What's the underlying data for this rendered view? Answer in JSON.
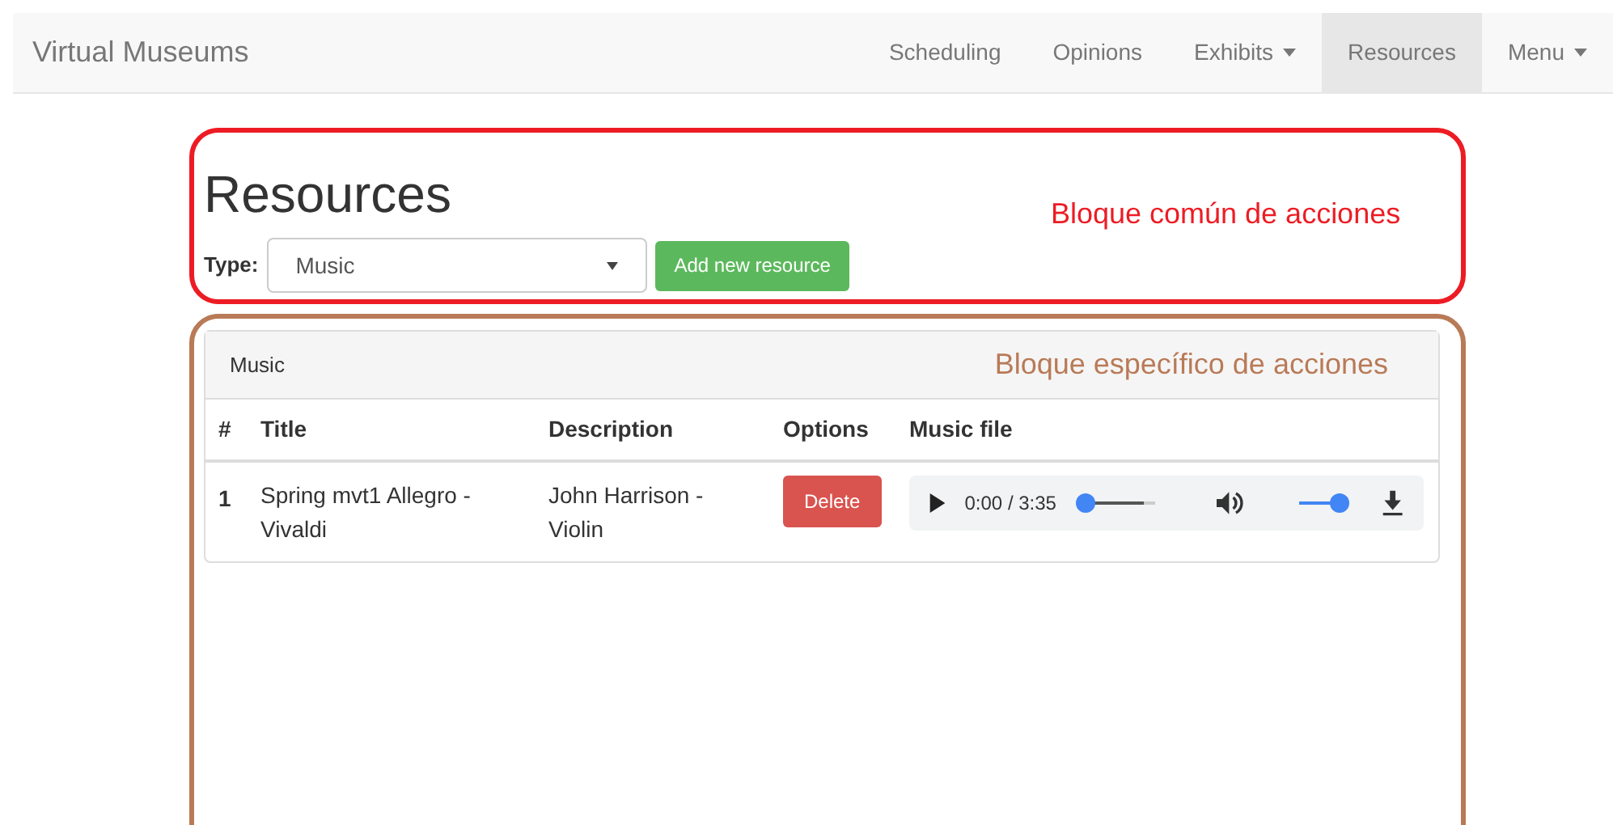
{
  "navbar": {
    "brand": "Virtual Museums",
    "items": [
      {
        "label": "Scheduling",
        "selected": false,
        "dropdown": false
      },
      {
        "label": "Opinions",
        "selected": false,
        "dropdown": false
      },
      {
        "label": "Exhibits",
        "selected": false,
        "dropdown": true
      },
      {
        "label": "Resources",
        "selected": true,
        "dropdown": false
      },
      {
        "label": "Menu",
        "selected": false,
        "dropdown": true
      }
    ]
  },
  "common_block": {
    "annotation": "Bloque común de acciones",
    "heading": "Resources",
    "type_label": "Type:",
    "type_select": {
      "value": "Music"
    },
    "add_button": "Add new resource"
  },
  "specific_block": {
    "annotation": "Bloque específico de acciones",
    "panel_title": "Music",
    "table": {
      "columns": [
        "#",
        "Title",
        "Description",
        "Options",
        "Music file"
      ],
      "rows": [
        {
          "number": "1",
          "title": "Spring mvt1 Allegro - Vivaldi",
          "description": "John Harrison - Violin",
          "delete_button": "Delete",
          "player": {
            "time": "0:00 / 3:35",
            "level": 0,
            "volume": {
              "level": 1
            }
          }
        }
      ]
    }
  }
}
